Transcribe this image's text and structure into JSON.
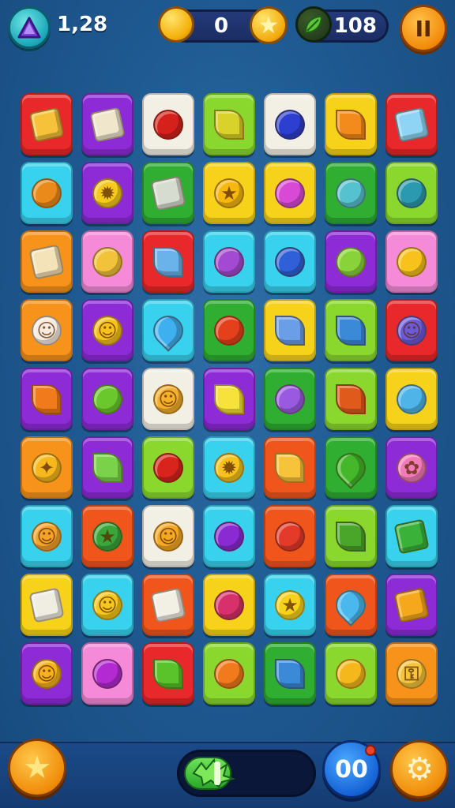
{
  "hud": {
    "level_label": "1,28",
    "coins": "0",
    "leaves": "108",
    "pause_label": "II",
    "level_icon": "triangle-gem-icon",
    "coin_icon": "gold-coin-icon",
    "star_coin_icon": "star-coin-icon",
    "leaf_icon": "leaf-icon"
  },
  "bottom": {
    "moves_label": "00",
    "progress": 0.38,
    "star_icon": "star-icon",
    "settings_icon": "gear-icon"
  },
  "colors": {
    "red": "#e8282a",
    "purple": "#8d2bd6",
    "white": "#f2efe4",
    "lime": "#8ad82e",
    "yellow": "#f7d21a",
    "cyan": "#38d2ee",
    "green": "#2fae32",
    "orange": "#f7931a",
    "pink": "#f58ad8",
    "deep_orange": "#f0561c"
  },
  "board": {
    "rows": [
      [
        {
          "bg": "red",
          "icon": "cheese-icon",
          "fill": "#f6c23a",
          "glyph": "",
          "shape": "square"
        },
        {
          "bg": "purple",
          "icon": "paper-icon",
          "fill": "#efe6cc",
          "glyph": "",
          "shape": "square"
        },
        {
          "bg": "white",
          "icon": "cherry-icon",
          "fill": "#d6201c",
          "glyph": "",
          "shape": ""
        },
        {
          "bg": "lime",
          "icon": "corn-icon",
          "fill": "#d9d22a",
          "glyph": "",
          "shape": "leaf"
        },
        {
          "bg": "white",
          "icon": "blueberry-icon",
          "fill": "#2c3fd0",
          "glyph": "",
          "shape": ""
        },
        {
          "bg": "yellow",
          "icon": "carrot-bunch-icon",
          "fill": "#f28a1c",
          "glyph": "",
          "shape": "leaf"
        },
        {
          "bg": "red",
          "icon": "ice-cube-icon",
          "fill": "#8fd4f5",
          "glyph": "",
          "shape": "square"
        }
      ],
      [
        {
          "bg": "cyan",
          "icon": "orange-slice-icon",
          "fill": "#e98a1a",
          "glyph": "",
          "shape": ""
        },
        {
          "bg": "purple",
          "icon": "sun-flower-icon",
          "fill": "#f6c91c",
          "glyph": "✹",
          "shape": ""
        },
        {
          "bg": "green",
          "icon": "crystal-icon",
          "fill": "#d6dccf",
          "glyph": "",
          "shape": "square"
        },
        {
          "bg": "yellow",
          "icon": "star-icon",
          "fill": "#f6b80f",
          "glyph": "★",
          "shape": ""
        },
        {
          "bg": "yellow",
          "icon": "lollipop-icon",
          "fill": "#d84ad6",
          "glyph": "",
          "shape": ""
        },
        {
          "bg": "green",
          "icon": "teal-candy-icon",
          "fill": "#56c2cf",
          "glyph": "",
          "shape": ""
        },
        {
          "bg": "lime",
          "icon": "wand-icon",
          "fill": "#2b9ab0",
          "glyph": "",
          "shape": ""
        }
      ],
      [
        {
          "bg": "orange",
          "icon": "egg-plate-icon",
          "fill": "#f4e2b8",
          "glyph": "",
          "shape": "square"
        },
        {
          "bg": "pink",
          "icon": "key-icon",
          "fill": "#f2c23a",
          "glyph": "",
          "shape": ""
        },
        {
          "bg": "red",
          "icon": "feather-icon",
          "fill": "#6ab3ea",
          "glyph": "",
          "shape": "leaf"
        },
        {
          "bg": "cyan",
          "icon": "plum-icon",
          "fill": "#a44ad2",
          "glyph": "",
          "shape": ""
        },
        {
          "bg": "cyan",
          "icon": "blue-fruit-icon",
          "fill": "#2f60d8",
          "glyph": "",
          "shape": ""
        },
        {
          "bg": "purple",
          "icon": "lime-icon",
          "fill": "#8ad23a",
          "glyph": "",
          "shape": ""
        },
        {
          "bg": "pink",
          "icon": "ring-icon",
          "fill": "#f7c21c",
          "glyph": "",
          "shape": ""
        }
      ],
      [
        {
          "bg": "orange",
          "icon": "cloud-face-icon",
          "fill": "#f7ece0",
          "glyph": "☺",
          "shape": "face"
        },
        {
          "bg": "purple",
          "icon": "smiley-icon",
          "fill": "#f6c21c",
          "glyph": "☺",
          "shape": "face"
        },
        {
          "bg": "cyan",
          "icon": "water-drop-icon",
          "fill": "#3fb0ef",
          "glyph": "",
          "shape": "drop"
        },
        {
          "bg": "green",
          "icon": "apple-icon",
          "fill": "#e4401c",
          "glyph": "",
          "shape": ""
        },
        {
          "bg": "yellow",
          "icon": "bottle-icon",
          "fill": "#6a9ee6",
          "glyph": "",
          "shape": "leaf"
        },
        {
          "bg": "lime",
          "icon": "blue-feather-icon",
          "fill": "#3b8ad8",
          "glyph": "",
          "shape": "leaf"
        },
        {
          "bg": "red",
          "icon": "monster-icon",
          "fill": "#6a5ad8",
          "glyph": "☺",
          "shape": "face"
        }
      ],
      [
        {
          "bg": "purple",
          "icon": "carrot-icon",
          "fill": "#f07a1c",
          "glyph": "",
          "shape": "leaf"
        },
        {
          "bg": "purple",
          "icon": "green-berry-icon",
          "fill": "#6ac82c",
          "glyph": "",
          "shape": ""
        },
        {
          "bg": "white",
          "icon": "flower-face-icon",
          "fill": "#f4b02a",
          "glyph": "☺",
          "shape": "face"
        },
        {
          "bg": "purple",
          "icon": "lemon-icon",
          "fill": "#f6e23a",
          "glyph": "",
          "shape": "leaf"
        },
        {
          "bg": "green",
          "icon": "map-pin-icon",
          "fill": "#9a5ae0",
          "glyph": "",
          "shape": ""
        },
        {
          "bg": "lime",
          "icon": "autumn-leaf-icon",
          "fill": "#e05a1c",
          "glyph": "",
          "shape": "leaf"
        },
        {
          "bg": "yellow",
          "icon": "magnifier-key-icon",
          "fill": "#4fb4e8",
          "glyph": "",
          "shape": ""
        }
      ],
      [
        {
          "bg": "orange",
          "icon": "sparkle-star-icon",
          "fill": "#f6b81c",
          "glyph": "✦",
          "shape": ""
        },
        {
          "bg": "purple",
          "icon": "cactus-icon",
          "fill": "#7ad24a",
          "glyph": "",
          "shape": "leaf"
        },
        {
          "bg": "lime",
          "icon": "red-bean-icon",
          "fill": "#d8241c",
          "glyph": "",
          "shape": ""
        },
        {
          "bg": "cyan",
          "icon": "cookie-icon",
          "fill": "#f7c21c",
          "glyph": "✹",
          "shape": ""
        },
        {
          "bg": "deep_orange",
          "icon": "cheese-wedge-icon",
          "fill": "#f6c33a",
          "glyph": "",
          "shape": "leaf"
        },
        {
          "bg": "green",
          "icon": "green-drop-icon",
          "fill": "#44b82a",
          "glyph": "",
          "shape": "drop"
        },
        {
          "bg": "purple",
          "icon": "pink-flower-icon",
          "fill": "#f27ab8",
          "glyph": "✿",
          "shape": ""
        }
      ],
      [
        {
          "bg": "cyan",
          "icon": "bear-face-icon",
          "fill": "#f4a22a",
          "glyph": "☺",
          "shape": "face"
        },
        {
          "bg": "deep_orange",
          "icon": "green-star-icon",
          "fill": "#3aa63a",
          "glyph": "★",
          "shape": ""
        },
        {
          "bg": "white",
          "icon": "acorn-face-icon",
          "fill": "#f4a824",
          "glyph": "☺",
          "shape": "face"
        },
        {
          "bg": "cyan",
          "icon": "grape-icon",
          "fill": "#8a2ad2",
          "glyph": "",
          "shape": ""
        },
        {
          "bg": "deep_orange",
          "icon": "red-orb-icon",
          "fill": "#e43a2a",
          "glyph": "",
          "shape": ""
        },
        {
          "bg": "lime",
          "icon": "leaf-icon",
          "fill": "#4aa62a",
          "glyph": "",
          "shape": "leaf"
        },
        {
          "bg": "cyan",
          "icon": "green-block-icon",
          "fill": "#3ab23a",
          "glyph": "",
          "shape": "square"
        }
      ],
      [
        {
          "bg": "yellow",
          "icon": "sugar-cube-icon",
          "fill": "#f0ede2",
          "glyph": "",
          "shape": "square"
        },
        {
          "bg": "cyan",
          "icon": "shield-face-icon",
          "fill": "#f6c81c",
          "glyph": "☺",
          "shape": "face"
        },
        {
          "bg": "deep_orange",
          "icon": "paper-fold-icon",
          "fill": "#f2efe4",
          "glyph": "",
          "shape": "square"
        },
        {
          "bg": "yellow",
          "icon": "pink-orb-icon",
          "fill": "#d8306a",
          "glyph": "",
          "shape": ""
        },
        {
          "bg": "cyan",
          "icon": "yellow-star-icon",
          "fill": "#f7d21c",
          "glyph": "★",
          "shape": ""
        },
        {
          "bg": "deep_orange",
          "icon": "blue-drop-icon",
          "fill": "#4ab8ec",
          "glyph": "",
          "shape": "drop"
        },
        {
          "bg": "purple",
          "icon": "amber-block-icon",
          "fill": "#f6a81c",
          "glyph": "",
          "shape": "square"
        }
      ],
      [
        {
          "bg": "purple",
          "icon": "sun-face-icon",
          "fill": "#f6b21c",
          "glyph": "☺",
          "shape": "face"
        },
        {
          "bg": "pink",
          "icon": "magenta-candy-icon",
          "fill": "#b42ad2",
          "glyph": "",
          "shape": ""
        },
        {
          "bg": "red",
          "icon": "green-pepper-icon",
          "fill": "#5ac22a",
          "glyph": "",
          "shape": "leaf"
        },
        {
          "bg": "lime",
          "icon": "orange-candy-icon",
          "fill": "#f07a1c",
          "glyph": "",
          "shape": ""
        },
        {
          "bg": "green",
          "icon": "blue-quill-icon",
          "fill": "#3a8ad8",
          "glyph": "",
          "shape": "leaf"
        },
        {
          "bg": "lime",
          "icon": "golden-egg-icon",
          "fill": "#f4b81c",
          "glyph": "",
          "shape": ""
        },
        {
          "bg": "orange",
          "icon": "gold-key-icon",
          "fill": "#f6c43a",
          "glyph": "⚿",
          "shape": ""
        }
      ]
    ]
  }
}
